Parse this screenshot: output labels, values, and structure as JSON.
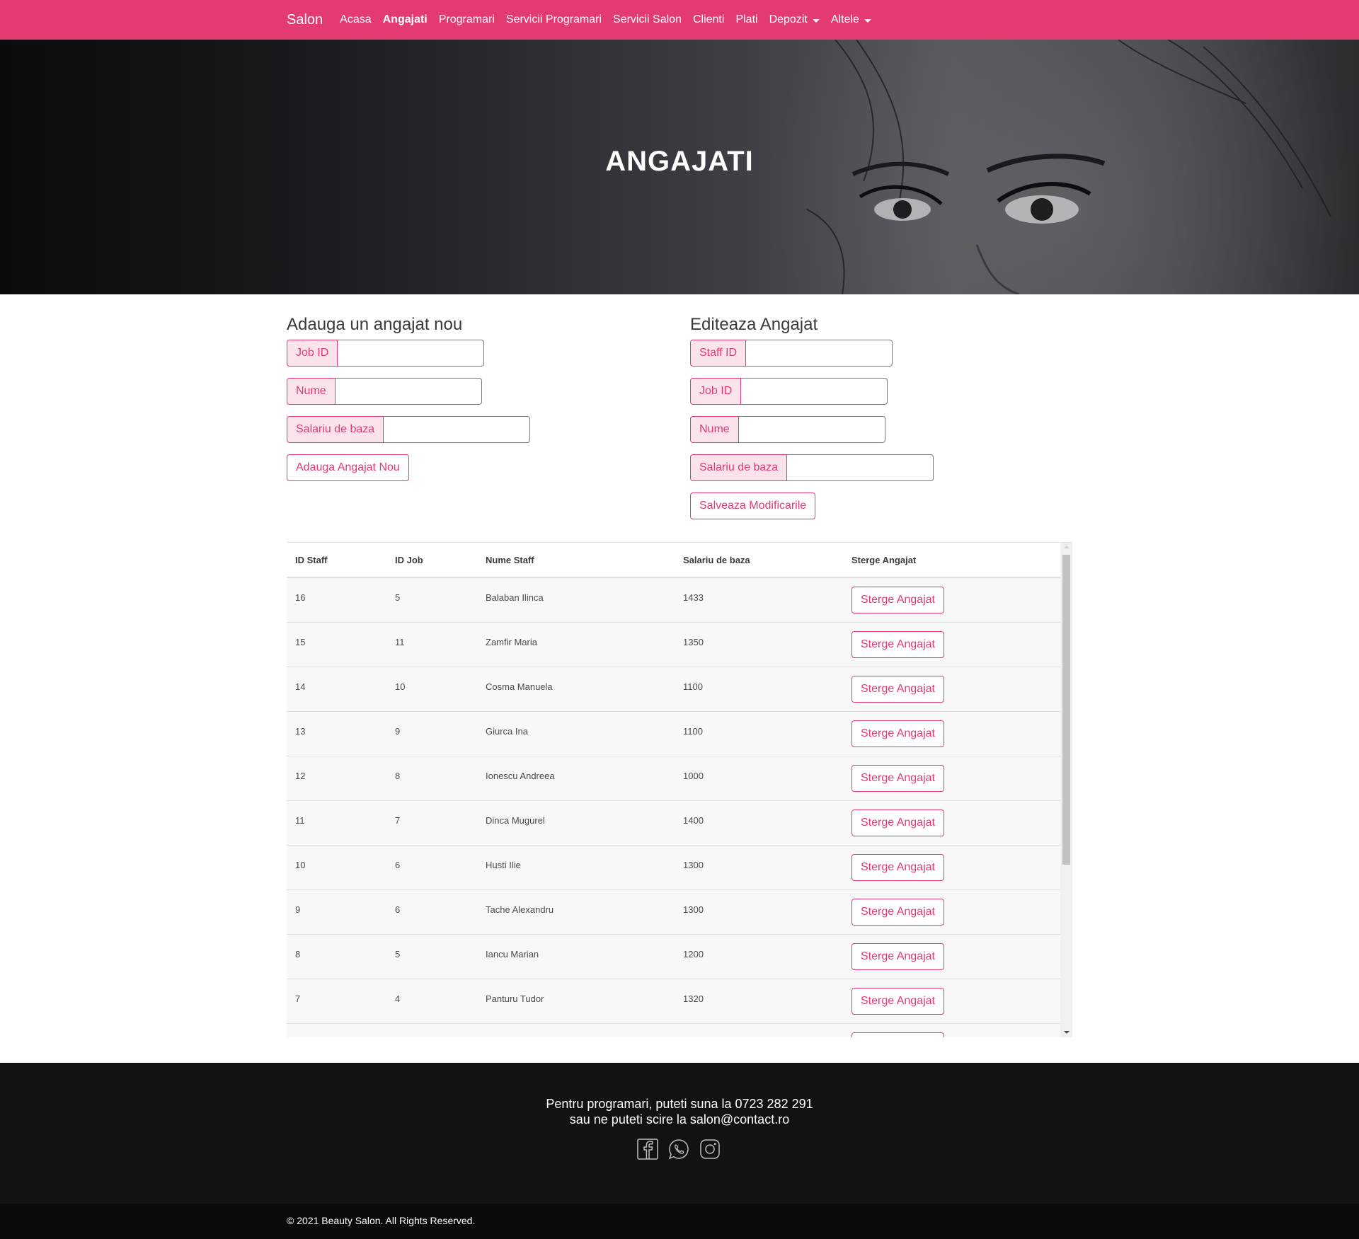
{
  "nav": {
    "brand": "Salon",
    "links": [
      "Acasa",
      "Angajati",
      "Programari",
      "Servicii Programari",
      "Servicii Salon",
      "Clienti",
      "Plati",
      "Depozit",
      "Altele"
    ],
    "active": "Angajati",
    "accent_color": "#e33a72"
  },
  "hero": {
    "title": "ANGAJATI"
  },
  "add_form": {
    "title": "Adauga un angajat nou",
    "fields": [
      {
        "label": "Job ID",
        "value": ""
      },
      {
        "label": "Nume",
        "value": ""
      },
      {
        "label": "Salariu de baza",
        "value": ""
      }
    ],
    "button": "Adauga Angajat Nou"
  },
  "edit_form": {
    "title": "Editeaza Angajat",
    "fields": [
      {
        "label": "Staff ID",
        "value": ""
      },
      {
        "label": "Job ID",
        "value": ""
      },
      {
        "label": "Nume",
        "value": ""
      },
      {
        "label": "Salariu de baza",
        "value": ""
      }
    ],
    "button": "Salveaza Modificarile"
  },
  "table": {
    "headers": [
      "ID Staff",
      "ID Job",
      "Nume Staff",
      "Salariu de baza",
      "Sterge Angajat"
    ],
    "delete_label": "Sterge Angajat",
    "rows": [
      {
        "id_staff": "16",
        "id_job": "5",
        "nume": "Balaban Ilinca",
        "salariu": "1433"
      },
      {
        "id_staff": "15",
        "id_job": "11",
        "nume": "Zamfir Maria",
        "salariu": "1350"
      },
      {
        "id_staff": "14",
        "id_job": "10",
        "nume": "Cosma Manuela",
        "salariu": "1100"
      },
      {
        "id_staff": "13",
        "id_job": "9",
        "nume": "Giurca Ina",
        "salariu": "1100"
      },
      {
        "id_staff": "12",
        "id_job": "8",
        "nume": "Ionescu Andreea",
        "salariu": "1000"
      },
      {
        "id_staff": "11",
        "id_job": "7",
        "nume": "Dinca Mugurel",
        "salariu": "1400"
      },
      {
        "id_staff": "10",
        "id_job": "6",
        "nume": "Husti Ilie",
        "salariu": "1300"
      },
      {
        "id_staff": "9",
        "id_job": "6",
        "nume": "Tache Alexandru",
        "salariu": "1300"
      },
      {
        "id_staff": "8",
        "id_job": "5",
        "nume": "Iancu Marian",
        "salariu": "1200"
      },
      {
        "id_staff": "7",
        "id_job": "4",
        "nume": "Panturu Tudor",
        "salariu": "1320"
      },
      {
        "id_staff": "",
        "id_job": "",
        "nume": "",
        "salariu": ""
      }
    ]
  },
  "footer": {
    "line1": "Pentru programari, puteti suna la 0723 282 291",
    "line2": "sau ne puteti scire la salon@contact.ro",
    "social_icons": [
      "facebook-icon",
      "whatsapp-icon",
      "instagram-icon"
    ],
    "copyright": "© 2021 Beauty Salon. All Rights Reserved."
  }
}
